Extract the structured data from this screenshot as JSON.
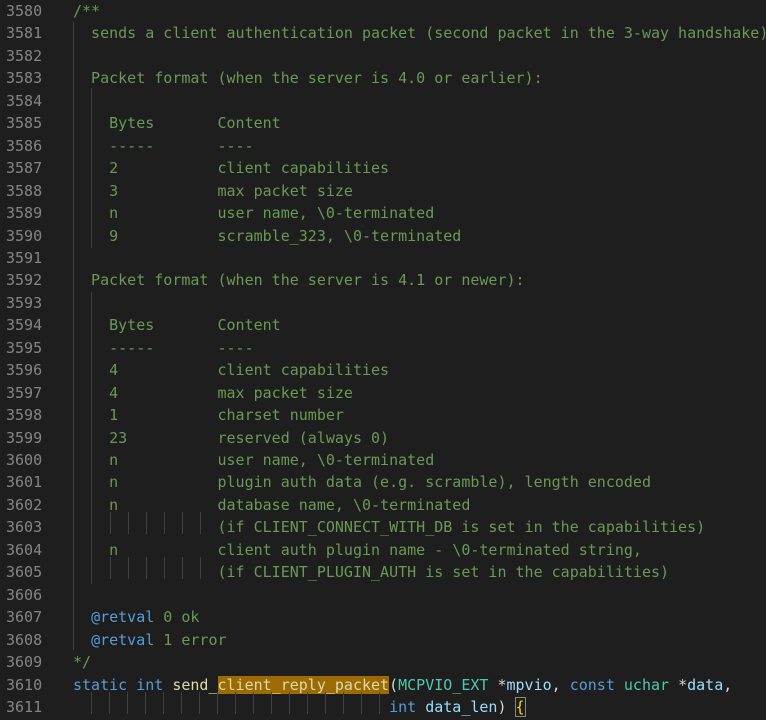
{
  "editor": {
    "lines": [
      {
        "n": "3580",
        "segs": [
          {
            "t": "/**",
            "c": "c"
          }
        ]
      },
      {
        "n": "3581",
        "segs": [
          {
            "t": "  sends a client authentication packet (second packet in the 3-way handshake)",
            "c": "c"
          }
        ]
      },
      {
        "n": "3582",
        "segs": []
      },
      {
        "n": "3583",
        "segs": [
          {
            "t": "  Packet format (when the server is 4.0 or earlier):",
            "c": "c"
          }
        ]
      },
      {
        "n": "3584",
        "segs": []
      },
      {
        "n": "3585",
        "segs": [
          {
            "t": "    Bytes       Content",
            "c": "c"
          }
        ]
      },
      {
        "n": "3586",
        "segs": [
          {
            "t": "    -----       ----",
            "c": "c"
          }
        ]
      },
      {
        "n": "3587",
        "segs": [
          {
            "t": "    2           client capabilities",
            "c": "c"
          }
        ]
      },
      {
        "n": "3588",
        "segs": [
          {
            "t": "    3           max packet size",
            "c": "c"
          }
        ]
      },
      {
        "n": "3589",
        "segs": [
          {
            "t": "    n           user name, \\0-terminated",
            "c": "c"
          }
        ]
      },
      {
        "n": "3590",
        "segs": [
          {
            "t": "    9           scramble_323, \\0-terminated",
            "c": "c"
          }
        ]
      },
      {
        "n": "3591",
        "segs": []
      },
      {
        "n": "3592",
        "segs": [
          {
            "t": "  Packet format (when the server is 4.1 or newer):",
            "c": "c"
          }
        ]
      },
      {
        "n": "3593",
        "segs": []
      },
      {
        "n": "3594",
        "segs": [
          {
            "t": "    Bytes       Content",
            "c": "c"
          }
        ]
      },
      {
        "n": "3595",
        "segs": [
          {
            "t": "    -----       ----",
            "c": "c"
          }
        ]
      },
      {
        "n": "3596",
        "segs": [
          {
            "t": "    4           client capabilities",
            "c": "c"
          }
        ]
      },
      {
        "n": "3597",
        "segs": [
          {
            "t": "    4           max packet size",
            "c": "c"
          }
        ]
      },
      {
        "n": "3598",
        "segs": [
          {
            "t": "    1           charset number",
            "c": "c"
          }
        ]
      },
      {
        "n": "3599",
        "segs": [
          {
            "t": "    23          reserved (always 0)",
            "c": "c"
          }
        ]
      },
      {
        "n": "3600",
        "segs": [
          {
            "t": "    n           user name, \\0-terminated",
            "c": "c"
          }
        ]
      },
      {
        "n": "3601",
        "segs": [
          {
            "t": "    n           plugin auth data (e.g. scramble), length encoded",
            "c": "c"
          }
        ]
      },
      {
        "n": "3602",
        "segs": [
          {
            "t": "    n           database name, \\0-terminated",
            "c": "c"
          }
        ]
      },
      {
        "n": "3603",
        "segs": [
          {
            "t": "                (if CLIENT_CONNECT_WITH_DB is set in the capabilities)",
            "c": "c"
          }
        ]
      },
      {
        "n": "3604",
        "segs": [
          {
            "t": "    n           client auth plugin name - \\0-terminated string,",
            "c": "c"
          }
        ]
      },
      {
        "n": "3605",
        "segs": [
          {
            "t": "                (if CLIENT_PLUGIN_AUTH is set in the capabilities)",
            "c": "c"
          }
        ]
      },
      {
        "n": "3606",
        "segs": []
      },
      {
        "n": "3607",
        "segs": [
          {
            "t": "  ",
            "c": "c"
          },
          {
            "t": "@retval",
            "c": "tag"
          },
          {
            "t": " 0 ok",
            "c": "c"
          }
        ]
      },
      {
        "n": "3608",
        "segs": [
          {
            "t": "  ",
            "c": "c"
          },
          {
            "t": "@retval",
            "c": "tag"
          },
          {
            "t": " 1 error",
            "c": "c"
          }
        ]
      },
      {
        "n": "3609",
        "segs": [
          {
            "t": "*/",
            "c": "c"
          }
        ]
      },
      {
        "n": "3610",
        "segs": [
          {
            "t": "static",
            "c": "kw"
          },
          {
            "t": " ",
            "c": "pl"
          },
          {
            "t": "int",
            "c": "kw"
          },
          {
            "t": " ",
            "c": "pl"
          },
          {
            "t": "send_",
            "c": "fn"
          },
          {
            "t": "client_reply_packet",
            "c": "hl"
          },
          {
            "t": "(",
            "c": "pl"
          },
          {
            "t": "MCPVIO_EXT",
            "c": "ty"
          },
          {
            "t": " *",
            "c": "pl"
          },
          {
            "t": "mpvio",
            "c": "var"
          },
          {
            "t": ", ",
            "c": "pl"
          },
          {
            "t": "const",
            "c": "kw"
          },
          {
            "t": " ",
            "c": "pl"
          },
          {
            "t": "uchar",
            "c": "ty"
          },
          {
            "t": " *",
            "c": "pl"
          },
          {
            "t": "data",
            "c": "var"
          },
          {
            "t": ",",
            "c": "pl"
          }
        ]
      },
      {
        "n": "3611",
        "segs": [
          {
            "t": "                                   ",
            "c": "pl"
          },
          {
            "t": "int",
            "c": "kw"
          },
          {
            "t": " ",
            "c": "pl"
          },
          {
            "t": "data_len",
            "c": "var"
          },
          {
            "t": ") ",
            "c": "pl"
          },
          {
            "t": "{",
            "c": "brace"
          }
        ]
      }
    ]
  }
}
